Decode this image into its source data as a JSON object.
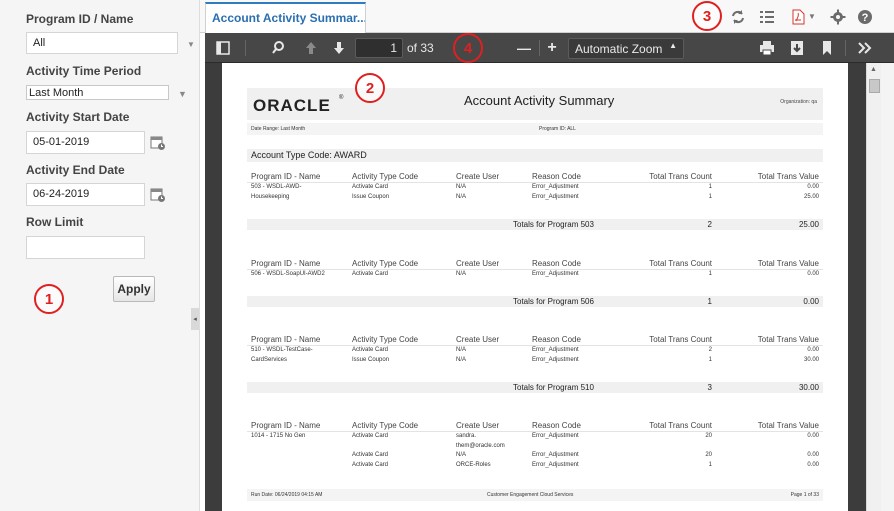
{
  "filters": {
    "program_label": "Program ID / Name",
    "program_value": "All",
    "period_label": "Activity Time Period",
    "period_value": "Last Month",
    "start_label": "Activity Start Date",
    "start_value": "05-01-2019",
    "end_label": "Activity End Date",
    "end_value": "06-24-2019",
    "rowlimit_label": "Row Limit",
    "rowlimit_value": "",
    "apply_label": "Apply"
  },
  "callouts": {
    "one": "1",
    "two": "2",
    "three": "3",
    "four": "4"
  },
  "tab": {
    "title": "Account Activity Summar..."
  },
  "pdf_toolbar": {
    "page_current": "1",
    "page_of": "of 33",
    "zoom": "Automatic Zoom",
    "minus": "—",
    "plus": "+"
  },
  "report": {
    "logo": "ORACLE",
    "logo_mark": "®",
    "title": "Account Activity Summary",
    "organization": "Organization: qa",
    "date_range": "Date Range: Last Month",
    "program_id": "Program ID: ALL",
    "account_type": "Account Type Code: AWARD",
    "columns": [
      "Program ID - Name",
      "Activity Type Code",
      "Create User",
      "Reason Code",
      "Total Trans Count",
      "Total Trans Value"
    ],
    "groups": [
      {
        "rows": [
          [
            "503 - WSDL-AWD-",
            "Activate Card",
            "N/A",
            "Error_Adjustment",
            "1",
            "0.00"
          ],
          [
            "Housekeeping",
            "Issue Coupon",
            "N/A",
            "Error_Adjustment",
            "1",
            "25.00"
          ]
        ],
        "total_label": "Totals for Program 503",
        "total_count": "2",
        "total_value": "25.00"
      },
      {
        "rows": [
          [
            "506 - WSDL-SoapUI-AWD2",
            "Activate Card",
            "N/A",
            "Error_Adjustment",
            "1",
            "0.00"
          ]
        ],
        "total_label": "Totals for Program 506",
        "total_count": "1",
        "total_value": "0.00"
      },
      {
        "rows": [
          [
            "510 - WSDL-TestCase-",
            "Activate Card",
            "N/A",
            "Error_Adjustment",
            "2",
            "0.00"
          ],
          [
            "CardServices",
            "Issue Coupon",
            "N/A",
            "Error_Adjustment",
            "1",
            "30.00"
          ]
        ],
        "total_label": "Totals for Program 510",
        "total_count": "3",
        "total_value": "30.00"
      },
      {
        "rows": [
          [
            "1014 - 1715 No Gen",
            "Activate Card",
            "sandra.",
            "Error_Adjustment",
            "20",
            "0.00"
          ],
          [
            "",
            "",
            "them@oracle.com",
            "",
            "",
            ""
          ],
          [
            "",
            "Activate Card",
            "N/A",
            "Error_Adjustment",
            "20",
            "0.00"
          ],
          [
            "",
            "Activate Card",
            "ORCE-Roles",
            "Error_Adjustment",
            "1",
            "0.00"
          ]
        ]
      }
    ],
    "run_date": "Run Date: 06/24/2019 04:15 AM",
    "service": "Customer Engagement Cloud Services",
    "page_footer": "Page 1 of 33"
  },
  "colors": {
    "accent": "#2f7cc1",
    "callout": "#e02020",
    "pdf_icon": "#d9332b"
  }
}
